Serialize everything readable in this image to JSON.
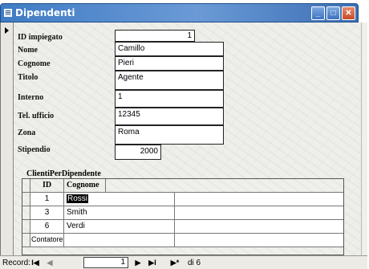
{
  "window": {
    "title": "Dipendenti",
    "min_glyph": "_",
    "max_glyph": "□",
    "close_glyph": "✕"
  },
  "form": {
    "fields": [
      {
        "label": "ID impiegato",
        "value": "1"
      },
      {
        "label": "Nome",
        "value": "Camillo"
      },
      {
        "label": "Cognome",
        "value": "Pieri"
      },
      {
        "label": "Titolo",
        "value": "Agente"
      },
      {
        "label": "Interno",
        "value": "1"
      },
      {
        "label": "Tel. ufficio",
        "value": "12345"
      },
      {
        "label": "Zona",
        "value": "Roma"
      },
      {
        "label": "Stipendio",
        "value": "2000"
      }
    ]
  },
  "subform": {
    "title": "ClientiPerDipendente",
    "headers": {
      "id": "ID",
      "cognome": "Cognome"
    },
    "rows": [
      {
        "id": "1",
        "cognome": "Rossi"
      },
      {
        "id": "3",
        "cognome": "Smith"
      },
      {
        "id": "6",
        "cognome": "Verdi"
      }
    ],
    "counter_label": "Contatore"
  },
  "navigation": {
    "record_label": "Record:",
    "current": "1",
    "of_text": "di 6",
    "first_glyph": "I◀",
    "prev_glyph": "◀",
    "next_glyph": "▶",
    "last_glyph": "▶I",
    "new_glyph": "▶*"
  }
}
